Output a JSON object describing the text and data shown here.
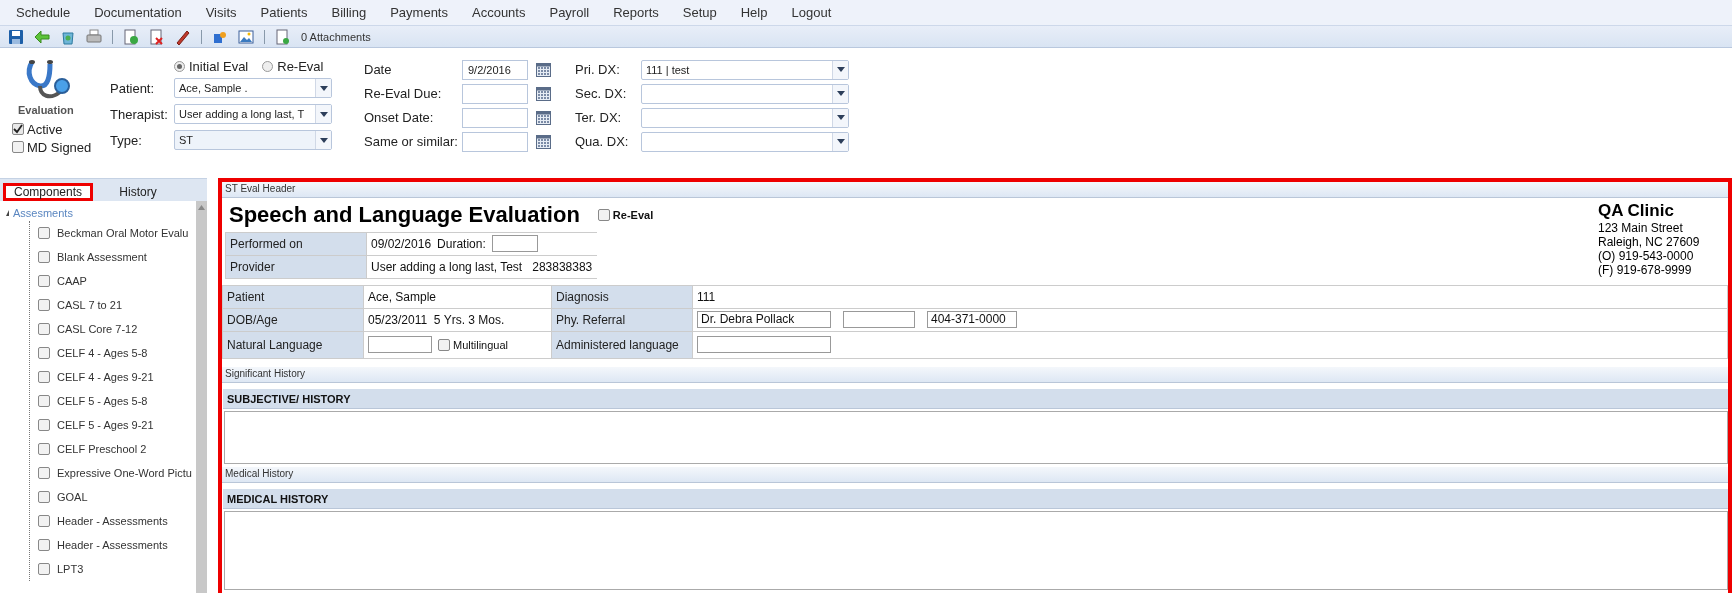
{
  "menu": [
    {
      "label": "Schedule"
    },
    {
      "label": "Documentation"
    },
    {
      "label": "Visits"
    },
    {
      "label": "Patients"
    },
    {
      "label": "Billing"
    },
    {
      "label": "Payments"
    },
    {
      "label": "Accounts"
    },
    {
      "label": "Payroll"
    },
    {
      "label": "Reports"
    },
    {
      "label": "Setup"
    },
    {
      "label": "Help"
    },
    {
      "label": "Logout"
    }
  ],
  "toolbar": {
    "attachments": "0 Attachments"
  },
  "evaluation": {
    "label": "Evaluation",
    "flags": [
      {
        "label": "Active",
        "checked": true
      },
      {
        "label": "MD Signed",
        "checked": false
      }
    ]
  },
  "eval_type": [
    {
      "label": "Initial Eval",
      "selected": true
    },
    {
      "label": "Re-Eval",
      "selected": false
    }
  ],
  "fields": [
    {
      "label": "Patient:",
      "value": "Ace, Sample  ."
    },
    {
      "label": "Therapist:",
      "value": "User adding a long last, T"
    },
    {
      "label": "Type:",
      "value": "ST"
    }
  ],
  "dates": [
    {
      "label": "Date",
      "value": "9/2/2016"
    },
    {
      "label": "Re-Eval Due:"
    },
    {
      "label": "Onset Date:"
    },
    {
      "label": "Same or similar:"
    }
  ],
  "dx": [
    {
      "label": "Pri. DX:",
      "value": "111 | test"
    },
    {
      "label": "Sec. DX:"
    },
    {
      "label": "Ter. DX:"
    },
    {
      "label": "Qua. DX:"
    }
  ],
  "side_tabs": [
    {
      "label": "Components",
      "selected": true,
      "highlighted": true
    },
    {
      "label": "History",
      "selected": false,
      "highlighted": false
    }
  ],
  "tree": {
    "label": "Assesments",
    "expanded": true,
    "children": [
      {
        "label": "Beckman Oral Motor Evalu",
        "checked": false
      },
      {
        "label": "Blank Assessment",
        "checked": false
      },
      {
        "label": "CAAP",
        "checked": false
      },
      {
        "label": "CASL 7 to 21",
        "checked": false
      },
      {
        "label": "CASL Core 7-12",
        "checked": false
      },
      {
        "label": "CELF 4 - Ages 5-8",
        "checked": false
      },
      {
        "label": "CELF 4 - Ages 9-21",
        "checked": false
      },
      {
        "label": "CELF 5 - Ages 5-8",
        "checked": false
      },
      {
        "label": "CELF 5 - Ages 9-21",
        "checked": false
      },
      {
        "label": "CELF Preschool 2",
        "checked": false
      },
      {
        "label": "Expressive One-Word Pictu",
        "checked": false
      },
      {
        "label": "GOAL",
        "checked": false
      },
      {
        "label": "Header - Assessments",
        "checked": false
      },
      {
        "label": "Header - Assessments",
        "checked": false
      },
      {
        "label": "LPT3",
        "checked": false
      }
    ]
  },
  "main": {
    "highlighted": true,
    "section": "ST Eval Header",
    "title": "Speech and Language Evaluation",
    "re_eval": {
      "label": "Re-Eval",
      "checked": false
    },
    "clinic": {
      "name": "QA Clinic",
      "lines": [
        "123 Main Street",
        "Raleigh, NC 27609",
        "(O) 919-543-0000",
        "(F) 919-678-9999"
      ]
    },
    "performed": {
      "label": "Performed on",
      "date": "09/02/2016",
      "duration_label": "Duration:"
    },
    "provider": {
      "label": "Provider",
      "value": "User adding a long last, Test   283838383"
    },
    "patient": {
      "label": "Patient",
      "value": "Ace, Sample"
    },
    "diagnosis": {
      "label": "Diagnosis",
      "value": "111"
    },
    "dob": {
      "label": "DOB/Age",
      "value": "05/23/2011  5 Yrs. 3 Mos."
    },
    "referral": {
      "label": "Phy. Referral",
      "physician": "Dr. Debra Pollack",
      "phone": "404-371-0000"
    },
    "natural_language": {
      "label": "Natural Language",
      "multilingual": {
        "label": "Multilingual",
        "checked": false
      }
    },
    "administered": {
      "label": "Administered language"
    },
    "sections": [
      {
        "title": "Significant History",
        "heading": "SUBJECTIVE/  HISTORY"
      },
      {
        "title": "Medical History",
        "heading": "MEDICAL HISTORY"
      }
    ]
  }
}
